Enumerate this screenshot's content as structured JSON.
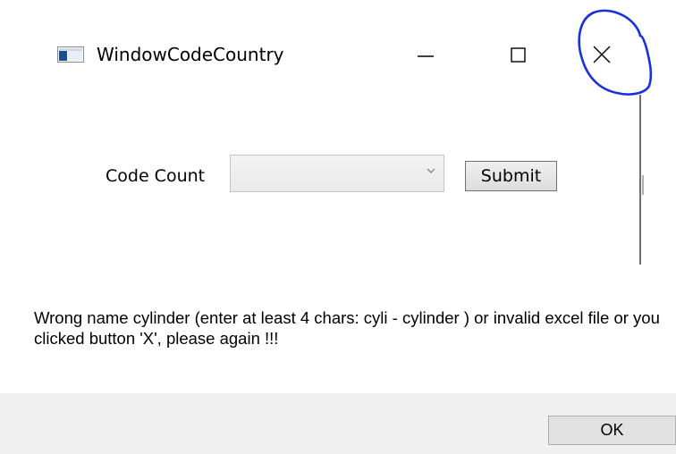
{
  "window": {
    "title": "WindowCodeCountry",
    "icon": "app-window-icon",
    "controls": [
      "minimize-icon",
      "maximize-icon",
      "close-icon"
    ]
  },
  "form": {
    "label": "Code Count",
    "select_value": "",
    "submit_label": "Submit"
  },
  "dialog": {
    "message": "Wrong name cylinder (enter at least 4 chars: cyli - cylinder ) or invalid excel file or you clicked button 'X', please again !!!",
    "ok_label": "OK"
  },
  "colors": {
    "annotation_circle": "#1a2fe0",
    "button_bar": "#f0f0f0"
  }
}
